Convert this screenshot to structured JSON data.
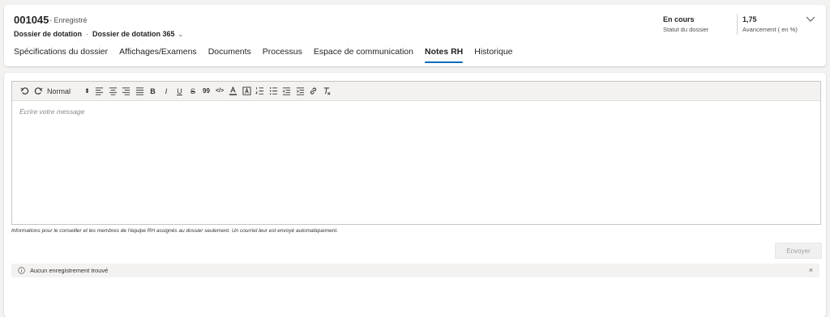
{
  "record": {
    "id": "001045",
    "status": "- Enregistré",
    "entity": "Dossier de dotation",
    "separator": "·",
    "form": "Dossier de dotation 365",
    "form_chevron": "⌄"
  },
  "kpis": [
    {
      "value": "En cours",
      "label": "Statut du dossier"
    },
    {
      "value": "1,75",
      "label": "Avancement ( en %)"
    }
  ],
  "tabs": [
    {
      "label": "Spécifications du dossier",
      "active": false
    },
    {
      "label": "Affichages/Examens",
      "active": false
    },
    {
      "label": "Documents",
      "active": false
    },
    {
      "label": "Processus",
      "active": false
    },
    {
      "label": "Espace de communication",
      "active": false
    },
    {
      "label": "Notes RH",
      "active": true
    },
    {
      "label": "Historique",
      "active": false
    }
  ],
  "editor": {
    "style_select": "Normal",
    "placeholder": "Écrire votre message",
    "tools": [
      "undo-icon",
      "redo-icon",
      "style-select",
      "align-left-icon",
      "align-center-icon",
      "align-right-icon",
      "align-justify-icon",
      "bold-icon",
      "italic-icon",
      "underline-icon",
      "strikethrough-icon",
      "blockquote-icon",
      "code-icon",
      "font-color-icon",
      "highlight-icon",
      "numbered-list-icon",
      "bullet-list-icon",
      "outdent-icon",
      "indent-icon",
      "link-icon",
      "clear-format-icon"
    ],
    "glyphs": {
      "bold": "B",
      "italic": "I",
      "underline": "U",
      "strike": "S",
      "quote": "99",
      "code": "</>",
      "updown": "⬍"
    }
  },
  "note": "Informations pour le conseiller et les membres de l'équipe RH assignés au dossier seulement. Un courriel leur est envoyé automatiquement.",
  "send_label": "Envoyer",
  "message": {
    "text": "Aucun enregistrement trouvé",
    "close": "×"
  },
  "colors": {
    "accent": "#0f6cbd",
    "background": "#f3f2f1"
  }
}
